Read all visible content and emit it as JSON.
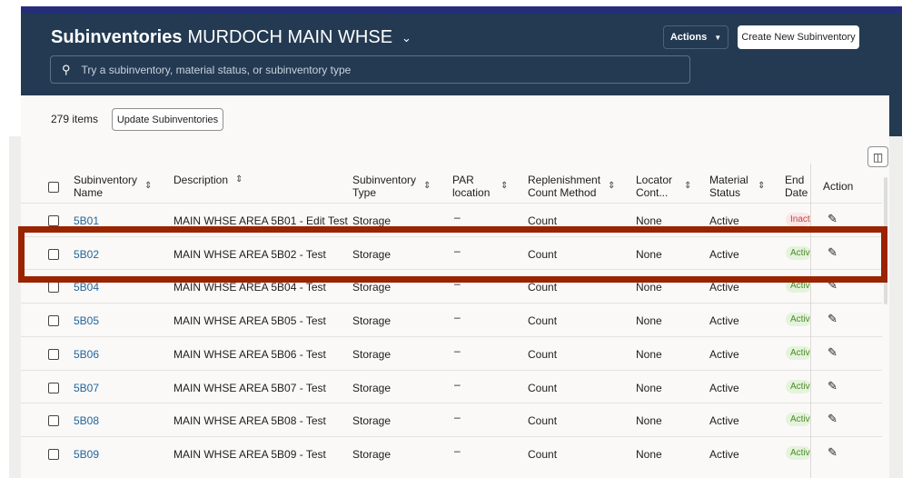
{
  "header": {
    "title": "Subinventories",
    "organization": "MURDOCH MAIN WHSE",
    "search_placeholder": "Try a subinventory, material status, or subinventory type",
    "actions_label": "Actions",
    "create_label": "Create New Subinventory"
  },
  "toolbar": {
    "count": "279 items",
    "update_label": "Update Subinventories"
  },
  "columns": [
    "Subinventory Name",
    "Description",
    "Subinventory Type",
    "PAR location",
    "Replenishment Count Method",
    "Locator Cont...",
    "Material Status",
    "End Date",
    "Action"
  ],
  "rows": [
    {
      "name": "5B01",
      "description": "MAIN WHSE AREA 5B01 - Edit Test",
      "type": "Storage",
      "par": "–",
      "method": "Count",
      "locator": "None",
      "status": "Active",
      "end": "Inact"
    },
    {
      "name": "5B02",
      "description": "MAIN WHSE AREA 5B02 - Test",
      "type": "Storage",
      "par": "–",
      "method": "Count",
      "locator": "None",
      "status": "Active",
      "end": "Activ"
    },
    {
      "name": "5B04",
      "description": "MAIN WHSE AREA 5B04 - Test",
      "type": "Storage",
      "par": "–",
      "method": "Count",
      "locator": "None",
      "status": "Active",
      "end": "Activ"
    },
    {
      "name": "5B05",
      "description": "MAIN WHSE AREA 5B05 - Test",
      "type": "Storage",
      "par": "–",
      "method": "Count",
      "locator": "None",
      "status": "Active",
      "end": "Activ"
    },
    {
      "name": "5B06",
      "description": "MAIN WHSE AREA 5B06 - Test",
      "type": "Storage",
      "par": "–",
      "method": "Count",
      "locator": "None",
      "status": "Active",
      "end": "Activ"
    },
    {
      "name": "5B07",
      "description": "MAIN WHSE AREA 5B07 - Test",
      "type": "Storage",
      "par": "–",
      "method": "Count",
      "locator": "None",
      "status": "Active",
      "end": "Activ"
    },
    {
      "name": "5B08",
      "description": "MAIN WHSE AREA 5B08 - Test",
      "type": "Storage",
      "par": "–",
      "method": "Count",
      "locator": "None",
      "status": "Active",
      "end": "Activ"
    },
    {
      "name": "5B09",
      "description": "MAIN WHSE AREA 5B09 - Test",
      "type": "Storage",
      "par": "–",
      "method": "Count",
      "locator": "None",
      "status": "Active",
      "end": "Activ"
    }
  ],
  "highlight_color": "#9a2300"
}
